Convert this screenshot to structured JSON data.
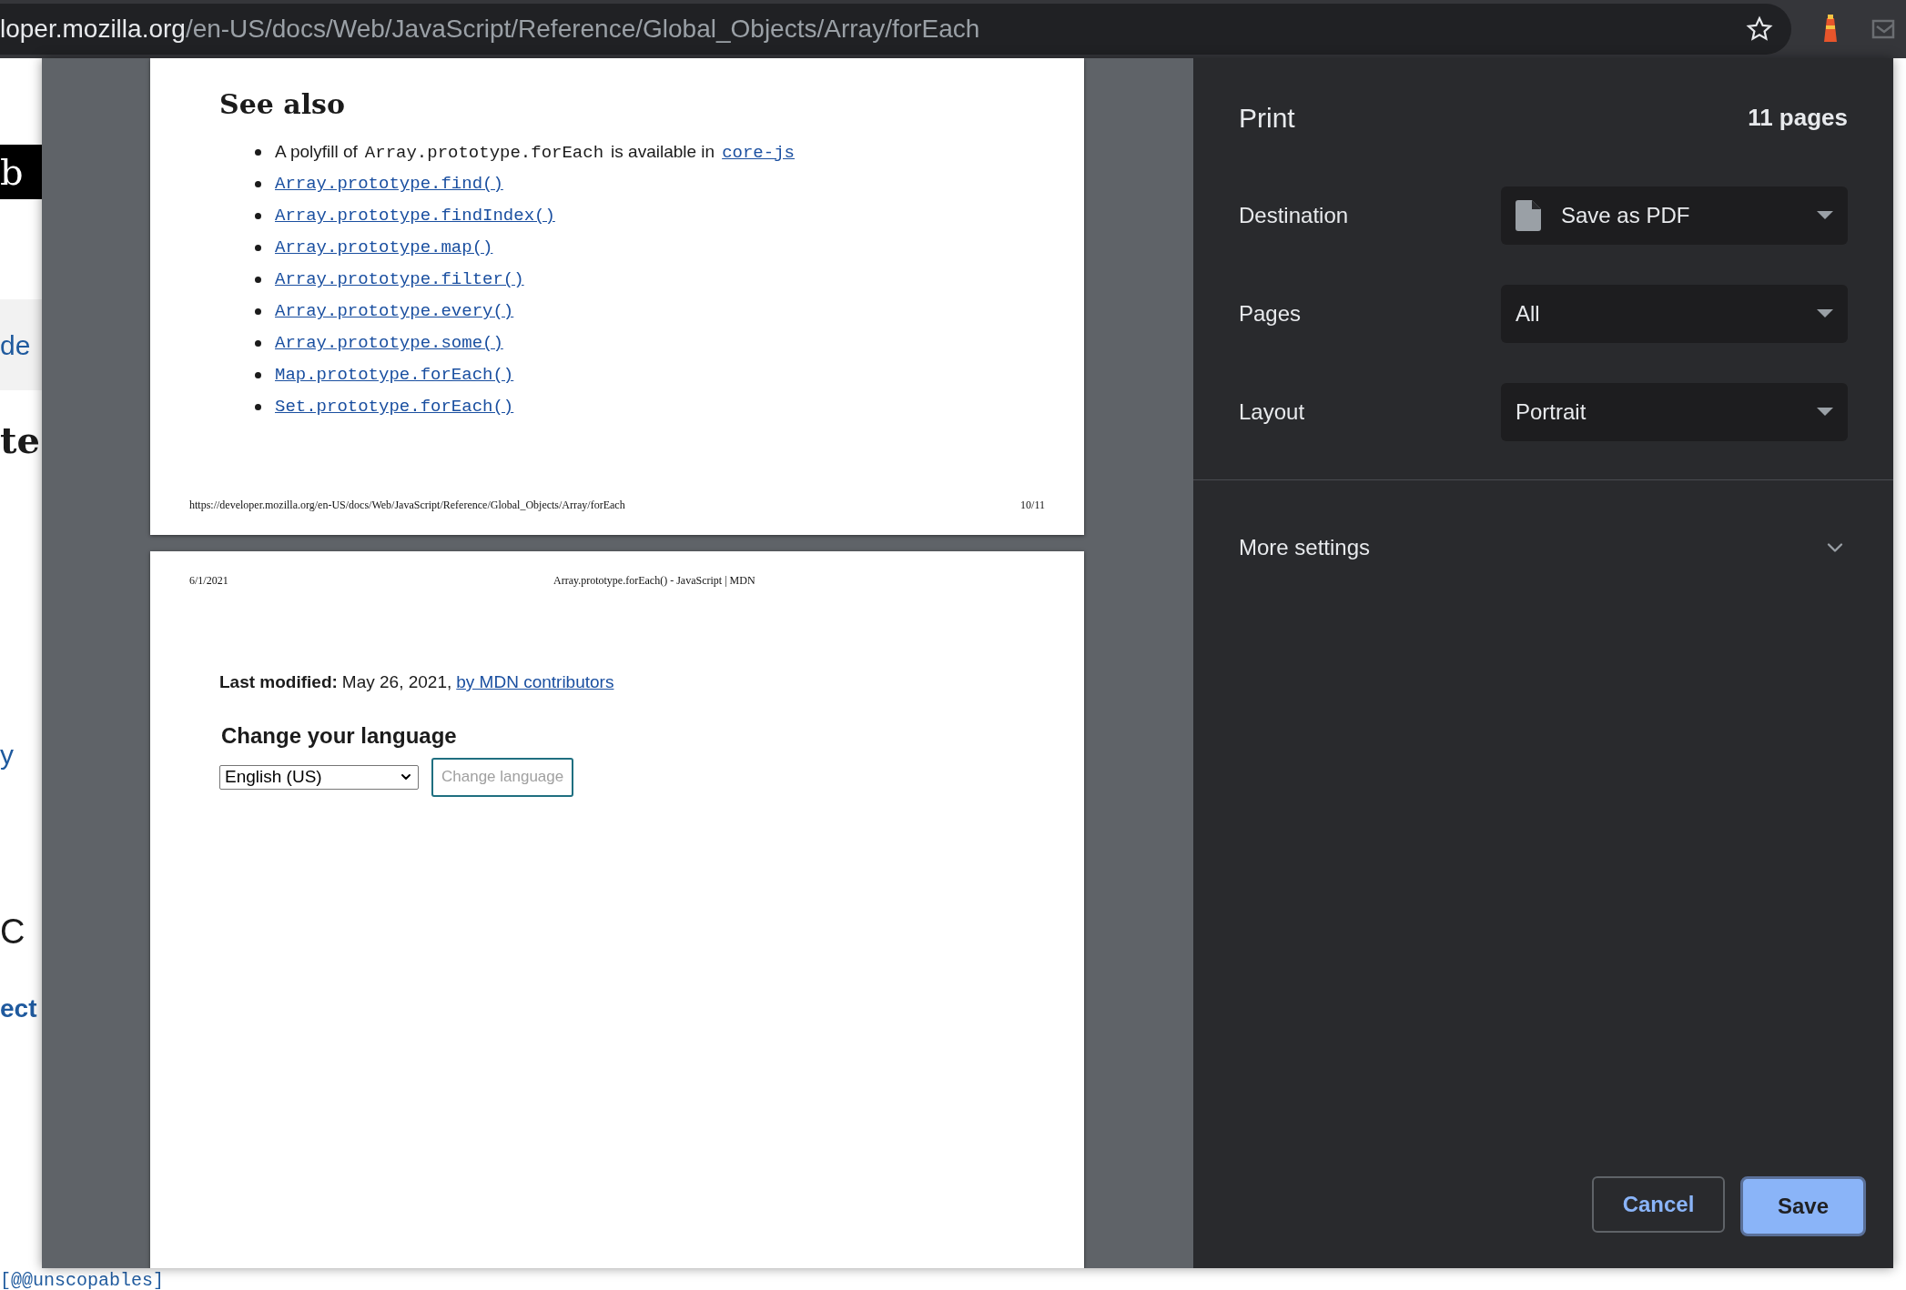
{
  "browser": {
    "url_host": "loper.mozilla.org",
    "url_path": "/en-US/docs/Web/JavaScript/Reference/Global_Objects/Array/forEach"
  },
  "background_page": {
    "fragments": [
      {
        "kind": "banner",
        "text": "b"
      },
      {
        "kind": "link_band",
        "text": "de"
      },
      {
        "kind": "heading",
        "text": "te"
      },
      {
        "kind": "link",
        "text": "y"
      },
      {
        "kind": "large",
        "text": "C"
      },
      {
        "kind": "bold_link",
        "text": "ect"
      },
      {
        "kind": "code",
        "text": "[@@unscopables]"
      }
    ]
  },
  "preview": {
    "page_1": {
      "heading": "See also",
      "items": [
        {
          "kind": "text",
          "before": "A polyfill of",
          "code": "Array.prototype.forEach",
          "after": "is available in",
          "link": "core-js"
        },
        {
          "kind": "link",
          "link": "Array.prototype.find()"
        },
        {
          "kind": "link",
          "link": "Array.prototype.findIndex()"
        },
        {
          "kind": "link",
          "link": "Array.prototype.map()"
        },
        {
          "kind": "link",
          "link": "Array.prototype.filter()"
        },
        {
          "kind": "link",
          "link": "Array.prototype.every()"
        },
        {
          "kind": "link",
          "link": "Array.prototype.some()"
        },
        {
          "kind": "link",
          "link": "Map.prototype.forEach()"
        },
        {
          "kind": "link",
          "link": "Set.prototype.forEach()"
        }
      ],
      "footer_url": "https://developer.mozilla.org/en-US/docs/Web/JavaScript/Reference/Global_Objects/Array/forEach",
      "page_number": "10/11"
    },
    "page_2": {
      "date": "6/1/2021",
      "title": "Array.prototype.forEach() - JavaScript | MDN",
      "last_modified": {
        "label": "Last modified:",
        "date": "May 26, 2021,",
        "link": "by MDN contributors"
      },
      "language": {
        "heading": "Change your language",
        "select_value": "English (US)",
        "button": "Change language"
      }
    }
  },
  "print_panel": {
    "title": "Print",
    "page_count": "11 pages",
    "settings": [
      {
        "label": "Destination",
        "value": "Save as PDF",
        "kind": "file"
      },
      {
        "label": "Pages",
        "value": "All",
        "kind": "plain"
      },
      {
        "label": "Layout",
        "value": "Portrait",
        "kind": "plain"
      }
    ],
    "more_settings": {
      "label": "More settings",
      "expanded": false
    },
    "buttons": {
      "cancel": "Cancel",
      "save": "Save"
    }
  }
}
